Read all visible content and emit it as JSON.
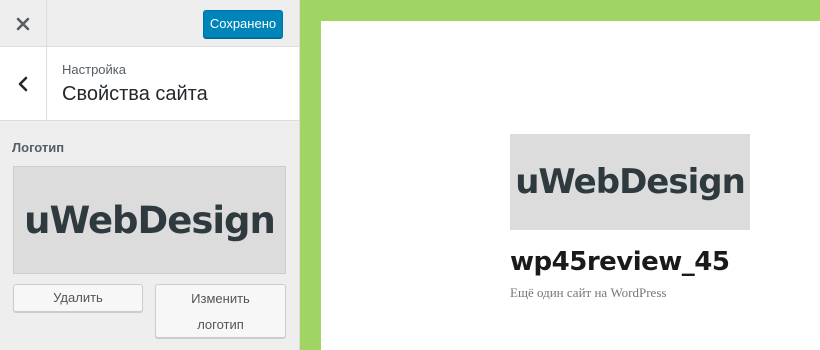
{
  "sidebar": {
    "save_label": "Сохранено",
    "breadcrumb": "Настройка",
    "section_title": "Свойства сайта",
    "logo_label": "Логотип",
    "logo_image_text": "uWebDesign",
    "remove_label": "Удалить",
    "change_label_line1": "Изменить",
    "change_label_line2": "логотип"
  },
  "preview": {
    "logo_image_text": "uWebDesign",
    "site_title": "wp45review_45",
    "site_description": "Ещё один сайт на WordPress"
  },
  "colors": {
    "accent": "#0085ba",
    "preview_border": "#a0d563",
    "sidebar_bg": "#eeeeee"
  },
  "icons": {
    "close": "close-icon",
    "back": "chevron-left-icon"
  }
}
